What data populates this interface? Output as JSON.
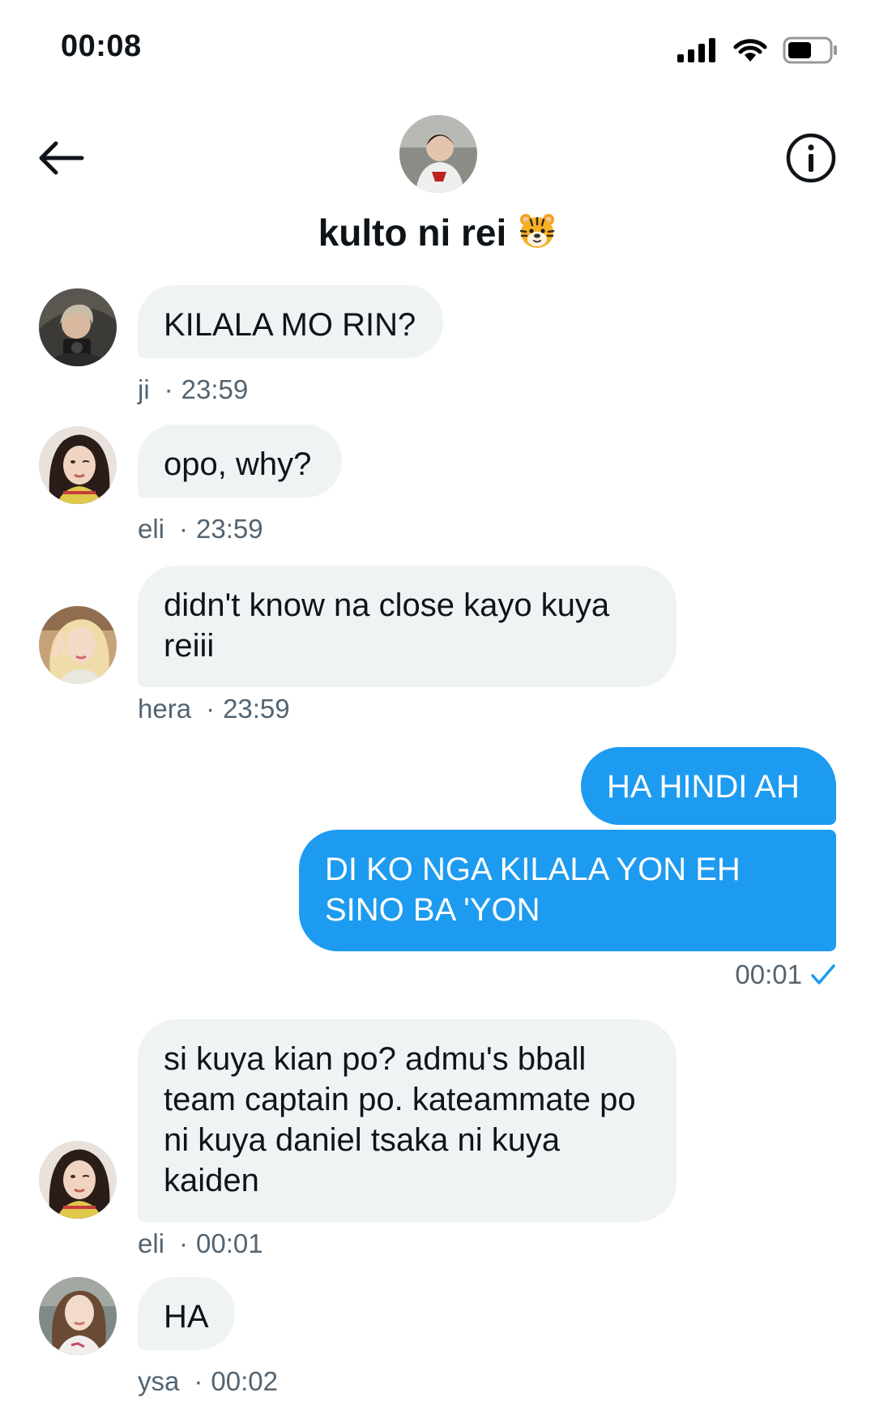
{
  "status_bar": {
    "time": "00:08"
  },
  "header": {
    "title": "kulto ni rei",
    "title_emoji": "tiger-face"
  },
  "colors": {
    "accent": "#1d9bf0",
    "bubble_in": "#eff3f4",
    "meta": "#536471"
  },
  "messages": [
    {
      "sender": "ji",
      "text": "KILALA MO RIN?",
      "time": "23:59"
    },
    {
      "sender": "eli",
      "text": "opo, why?",
      "time": "23:59"
    },
    {
      "sender": "hera",
      "text": "didn't know na close kayo kuya reiii",
      "time": "23:59"
    },
    {
      "text": "HA HINDI AH"
    },
    {
      "text": "DI KO NGA KILALA YON EH SINO BA 'YON",
      "time": "00:01",
      "status_icon": "check-icon"
    },
    {
      "sender": "eli",
      "text": "si kuya kian po? admu's bball team captain po. kateammate po ni kuya daniel tsaka ni kuya kaiden",
      "time": "00:01"
    },
    {
      "sender": "ysa",
      "text": "HA",
      "time": "00:02"
    }
  ]
}
